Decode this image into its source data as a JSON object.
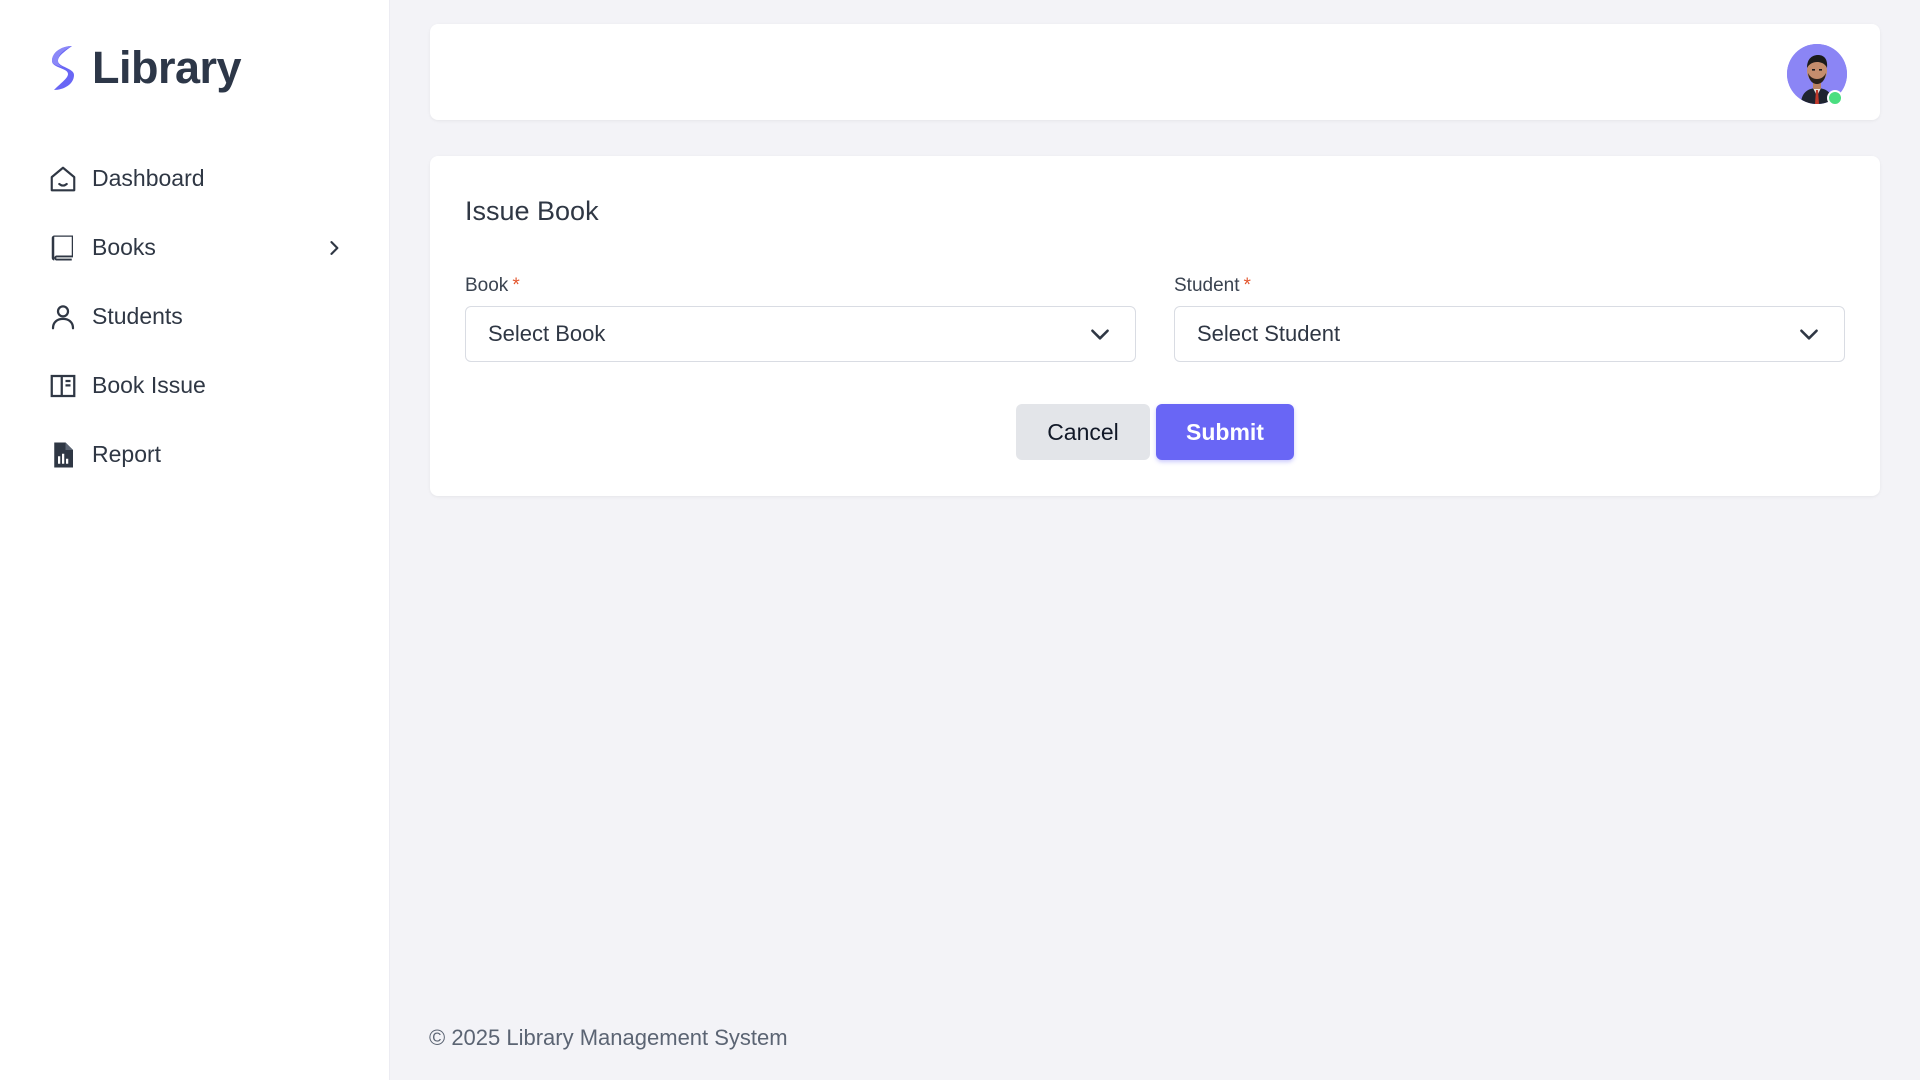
{
  "brand": {
    "name": "Library",
    "logo_icon": "brand-s-icon",
    "accent_color": "#6966f5"
  },
  "sidebar": {
    "items": [
      {
        "label": "Dashboard",
        "icon": "home-icon"
      },
      {
        "label": "Books",
        "icon": "book-icon",
        "has_submenu": true
      },
      {
        "label": "Students",
        "icon": "user-icon"
      },
      {
        "label": "Book Issue",
        "icon": "book-open-icon"
      },
      {
        "label": "Report",
        "icon": "report-icon"
      }
    ]
  },
  "header": {
    "avatar_icon": "avatar",
    "status_color": "#4ade80"
  },
  "form": {
    "title": "Issue Book",
    "book": {
      "label": "Book",
      "required_mark": "*",
      "value": "Select Book"
    },
    "student": {
      "label": "Student",
      "required_mark": "*",
      "value": "Select Student"
    },
    "cancel_label": "Cancel",
    "submit_label": "Submit"
  },
  "footer": {
    "text": "© 2025 Library Management System"
  }
}
